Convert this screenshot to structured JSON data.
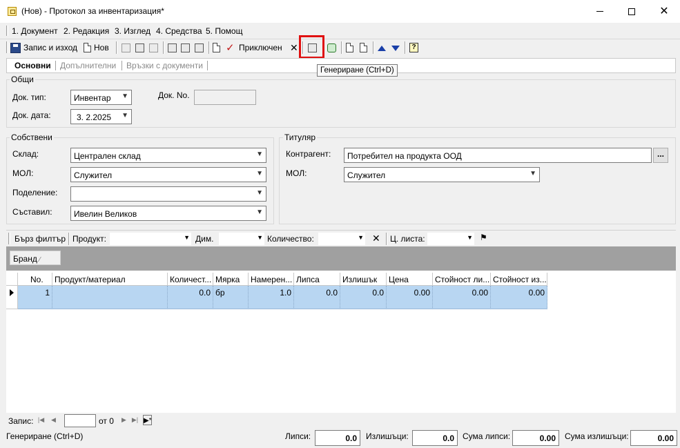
{
  "window": {
    "title": "(Нов) - Протокол за инвентаризация*",
    "close_glyph": "✕"
  },
  "menu": [
    "1. Документ",
    "2. Редакция",
    "3. Изглед",
    "4. Средства",
    "5. Помощ"
  ],
  "toolbar": {
    "save_exit_label": "Запис и изход",
    "new_label": "Нов",
    "finish_label": "Приключен",
    "help_glyph": "?",
    "tooltip": "Генериране (Ctrl+D)"
  },
  "tabs": [
    "Основни",
    "Допълнителни",
    "Връзки с документи"
  ],
  "general": {
    "title": "Общи",
    "doc_type_label": "Док. тип:",
    "doc_type_value": "Инвентар",
    "doc_no_label": "Док. No.",
    "doc_no_value": "",
    "doc_date_label": "Док. дата:",
    "doc_date_value": "3.  2.2025"
  },
  "own": {
    "title": "Собствени",
    "warehouse_label": "Склад:",
    "warehouse_value": "Централен склад",
    "mol_label": "МОЛ:",
    "mol_value": "Служител",
    "division_label": "Поделение:",
    "division_value": "",
    "author_label": "Съставил:",
    "author_value": "Ивелин Великов"
  },
  "holder": {
    "title": "Титуляр",
    "partner_label": "Контрагент:",
    "partner_value": "Потребител на продукта ООД",
    "ellipsis": "...",
    "mol_label": "МОЛ:",
    "mol_value": "Служител"
  },
  "filter": {
    "quick_filter": "Бърз филтър",
    "product_label": "Продукт:",
    "dim_label": "Дим.",
    "qty_label": "Количество:",
    "price_list_label": "Ц. листа:"
  },
  "groupby": {
    "chip": "Бранд",
    "chip_sort": "⁄"
  },
  "grid": {
    "columns": [
      "No.",
      "Продукт/материал",
      "Количест...",
      "Мярка",
      "Намерен...",
      "Липса",
      "Излишък",
      "Цена",
      "Стойност ли...",
      "Стойност из..."
    ],
    "rows": [
      [
        "1",
        "",
        "0.0",
        "бр",
        "1.0",
        "0.0",
        "0.0",
        "0.00",
        "0.00",
        "0.00"
      ]
    ]
  },
  "navigator": {
    "record_label": "Запис:",
    "of_label": "от 0"
  },
  "status": {
    "text": "Генериране (Ctrl+D)",
    "shortages_label": "Липси:",
    "shortages_value": "0.0",
    "surpluses_label": "Излишъци:",
    "surpluses_value": "0.0",
    "shortage_sum_label": "Сума липси:",
    "shortage_sum_value": "0.00",
    "surplus_sum_label": "Сума излишъци:",
    "surplus_sum_value": "0.00"
  }
}
